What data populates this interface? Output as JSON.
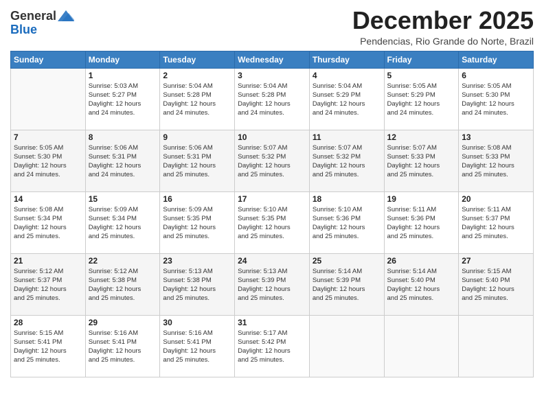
{
  "logo": {
    "general": "General",
    "blue": "Blue"
  },
  "header": {
    "month_title": "December 2025",
    "subtitle": "Pendencias, Rio Grande do Norte, Brazil"
  },
  "days_of_week": [
    "Sunday",
    "Monday",
    "Tuesday",
    "Wednesday",
    "Thursday",
    "Friday",
    "Saturday"
  ],
  "weeks": [
    [
      {
        "day": "",
        "sunrise": "",
        "sunset": "",
        "daylight": ""
      },
      {
        "day": "1",
        "sunrise": "Sunrise: 5:03 AM",
        "sunset": "Sunset: 5:27 PM",
        "daylight": "Daylight: 12 hours and 24 minutes."
      },
      {
        "day": "2",
        "sunrise": "Sunrise: 5:04 AM",
        "sunset": "Sunset: 5:28 PM",
        "daylight": "Daylight: 12 hours and 24 minutes."
      },
      {
        "day": "3",
        "sunrise": "Sunrise: 5:04 AM",
        "sunset": "Sunset: 5:28 PM",
        "daylight": "Daylight: 12 hours and 24 minutes."
      },
      {
        "day": "4",
        "sunrise": "Sunrise: 5:04 AM",
        "sunset": "Sunset: 5:29 PM",
        "daylight": "Daylight: 12 hours and 24 minutes."
      },
      {
        "day": "5",
        "sunrise": "Sunrise: 5:05 AM",
        "sunset": "Sunset: 5:29 PM",
        "daylight": "Daylight: 12 hours and 24 minutes."
      },
      {
        "day": "6",
        "sunrise": "Sunrise: 5:05 AM",
        "sunset": "Sunset: 5:30 PM",
        "daylight": "Daylight: 12 hours and 24 minutes."
      }
    ],
    [
      {
        "day": "7",
        "sunrise": "Sunrise: 5:05 AM",
        "sunset": "Sunset: 5:30 PM",
        "daylight": "Daylight: 12 hours and 24 minutes."
      },
      {
        "day": "8",
        "sunrise": "Sunrise: 5:06 AM",
        "sunset": "Sunset: 5:31 PM",
        "daylight": "Daylight: 12 hours and 24 minutes."
      },
      {
        "day": "9",
        "sunrise": "Sunrise: 5:06 AM",
        "sunset": "Sunset: 5:31 PM",
        "daylight": "Daylight: 12 hours and 25 minutes."
      },
      {
        "day": "10",
        "sunrise": "Sunrise: 5:07 AM",
        "sunset": "Sunset: 5:32 PM",
        "daylight": "Daylight: 12 hours and 25 minutes."
      },
      {
        "day": "11",
        "sunrise": "Sunrise: 5:07 AM",
        "sunset": "Sunset: 5:32 PM",
        "daylight": "Daylight: 12 hours and 25 minutes."
      },
      {
        "day": "12",
        "sunrise": "Sunrise: 5:07 AM",
        "sunset": "Sunset: 5:33 PM",
        "daylight": "Daylight: 12 hours and 25 minutes."
      },
      {
        "day": "13",
        "sunrise": "Sunrise: 5:08 AM",
        "sunset": "Sunset: 5:33 PM",
        "daylight": "Daylight: 12 hours and 25 minutes."
      }
    ],
    [
      {
        "day": "14",
        "sunrise": "Sunrise: 5:08 AM",
        "sunset": "Sunset: 5:34 PM",
        "daylight": "Daylight: 12 hours and 25 minutes."
      },
      {
        "day": "15",
        "sunrise": "Sunrise: 5:09 AM",
        "sunset": "Sunset: 5:34 PM",
        "daylight": "Daylight: 12 hours and 25 minutes."
      },
      {
        "day": "16",
        "sunrise": "Sunrise: 5:09 AM",
        "sunset": "Sunset: 5:35 PM",
        "daylight": "Daylight: 12 hours and 25 minutes."
      },
      {
        "day": "17",
        "sunrise": "Sunrise: 5:10 AM",
        "sunset": "Sunset: 5:35 PM",
        "daylight": "Daylight: 12 hours and 25 minutes."
      },
      {
        "day": "18",
        "sunrise": "Sunrise: 5:10 AM",
        "sunset": "Sunset: 5:36 PM",
        "daylight": "Daylight: 12 hours and 25 minutes."
      },
      {
        "day": "19",
        "sunrise": "Sunrise: 5:11 AM",
        "sunset": "Sunset: 5:36 PM",
        "daylight": "Daylight: 12 hours and 25 minutes."
      },
      {
        "day": "20",
        "sunrise": "Sunrise: 5:11 AM",
        "sunset": "Sunset: 5:37 PM",
        "daylight": "Daylight: 12 hours and 25 minutes."
      }
    ],
    [
      {
        "day": "21",
        "sunrise": "Sunrise: 5:12 AM",
        "sunset": "Sunset: 5:37 PM",
        "daylight": "Daylight: 12 hours and 25 minutes."
      },
      {
        "day": "22",
        "sunrise": "Sunrise: 5:12 AM",
        "sunset": "Sunset: 5:38 PM",
        "daylight": "Daylight: 12 hours and 25 minutes."
      },
      {
        "day": "23",
        "sunrise": "Sunrise: 5:13 AM",
        "sunset": "Sunset: 5:38 PM",
        "daylight": "Daylight: 12 hours and 25 minutes."
      },
      {
        "day": "24",
        "sunrise": "Sunrise: 5:13 AM",
        "sunset": "Sunset: 5:39 PM",
        "daylight": "Daylight: 12 hours and 25 minutes."
      },
      {
        "day": "25",
        "sunrise": "Sunrise: 5:14 AM",
        "sunset": "Sunset: 5:39 PM",
        "daylight": "Daylight: 12 hours and 25 minutes."
      },
      {
        "day": "26",
        "sunrise": "Sunrise: 5:14 AM",
        "sunset": "Sunset: 5:40 PM",
        "daylight": "Daylight: 12 hours and 25 minutes."
      },
      {
        "day": "27",
        "sunrise": "Sunrise: 5:15 AM",
        "sunset": "Sunset: 5:40 PM",
        "daylight": "Daylight: 12 hours and 25 minutes."
      }
    ],
    [
      {
        "day": "28",
        "sunrise": "Sunrise: 5:15 AM",
        "sunset": "Sunset: 5:41 PM",
        "daylight": "Daylight: 12 hours and 25 minutes."
      },
      {
        "day": "29",
        "sunrise": "Sunrise: 5:16 AM",
        "sunset": "Sunset: 5:41 PM",
        "daylight": "Daylight: 12 hours and 25 minutes."
      },
      {
        "day": "30",
        "sunrise": "Sunrise: 5:16 AM",
        "sunset": "Sunset: 5:41 PM",
        "daylight": "Daylight: 12 hours and 25 minutes."
      },
      {
        "day": "31",
        "sunrise": "Sunrise: 5:17 AM",
        "sunset": "Sunset: 5:42 PM",
        "daylight": "Daylight: 12 hours and 25 minutes."
      },
      {
        "day": "",
        "sunrise": "",
        "sunset": "",
        "daylight": ""
      },
      {
        "day": "",
        "sunrise": "",
        "sunset": "",
        "daylight": ""
      },
      {
        "day": "",
        "sunrise": "",
        "sunset": "",
        "daylight": ""
      }
    ]
  ]
}
